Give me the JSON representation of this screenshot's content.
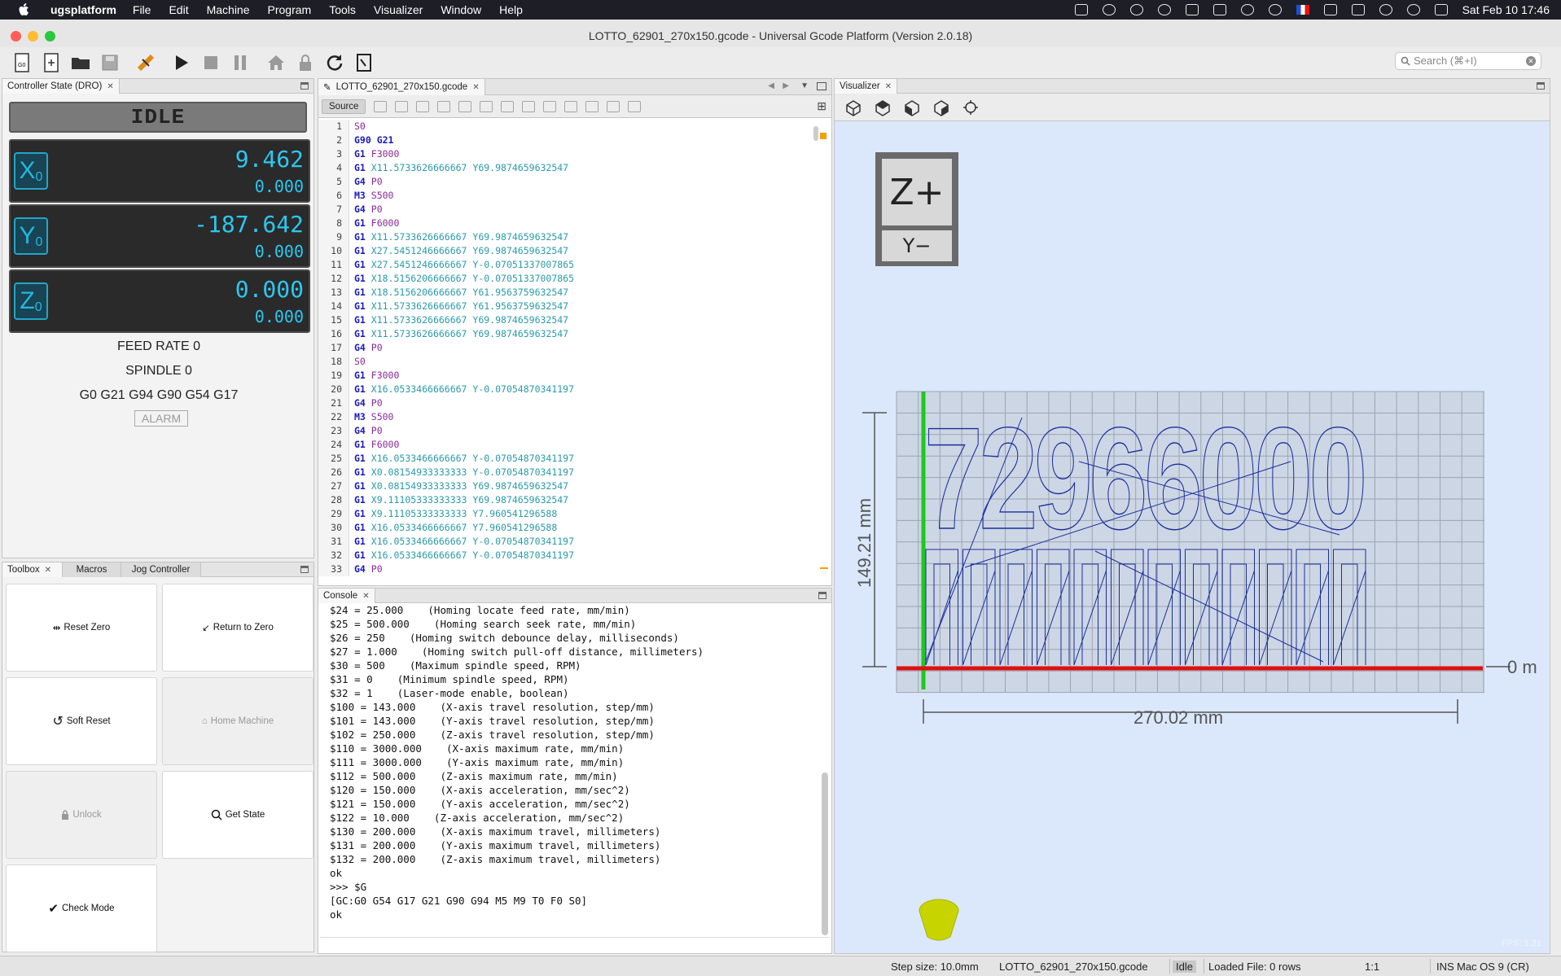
{
  "menubar": {
    "app_name": "ugsplatform",
    "items": [
      "File",
      "Edit",
      "Machine",
      "Program",
      "Tools",
      "Visualizer",
      "Window",
      "Help"
    ],
    "clock": "Sat Feb 10  17:46"
  },
  "window": {
    "title": "LOTTO_62901_270x150.gcode - Universal Gcode Platform (Version 2.0.18)"
  },
  "search": {
    "placeholder": "Search (⌘+I)"
  },
  "dro": {
    "tab": "Controller State (DRO)",
    "state": "IDLE",
    "axes": [
      {
        "name": "X",
        "sub": "0",
        "machine": "9.462",
        "work": "0.000"
      },
      {
        "name": "Y",
        "sub": "0",
        "machine": "-187.642",
        "work": "0.000"
      },
      {
        "name": "Z",
        "sub": "0",
        "machine": "0.000",
        "work": "0.000"
      }
    ],
    "feed_rate": "FEED RATE 0",
    "spindle": "SPINDLE 0",
    "gcode_state": "G0 G21 G94 G90 G54 G17",
    "alarm": "ALARM"
  },
  "toolbox": {
    "tabs": [
      "Toolbox",
      "Macros",
      "Jog Controller"
    ],
    "buttons": {
      "reset_zero": "Reset Zero",
      "return_to_zero": "Return to Zero",
      "soft_reset": "Soft Reset",
      "home_machine": "Home Machine",
      "unlock": "Unlock",
      "get_state": "Get State",
      "check_mode": "Check Mode"
    }
  },
  "editor": {
    "tab": "LOTTO_62901_270x150.gcode",
    "source_label": "Source",
    "lines": [
      [
        "S0",
        "",
        ""
      ],
      [
        "G90 G21",
        "",
        ""
      ],
      [
        "G1",
        "F3000",
        ""
      ],
      [
        "G1",
        "X11.5733626666667 Y69.9874659632547",
        ""
      ],
      [
        "G4",
        "P0",
        ""
      ],
      [
        "M3",
        "S500",
        ""
      ],
      [
        "G4",
        "P0",
        ""
      ],
      [
        "G1",
        "F6000",
        ""
      ],
      [
        "G1",
        "X11.5733626666667 Y69.9874659632547",
        ""
      ],
      [
        "G1",
        "X27.5451246666667 Y69.9874659632547",
        ""
      ],
      [
        "G1",
        "X27.5451246666667 Y-0.07051337007865",
        ""
      ],
      [
        "G1",
        "X18.5156206666667 Y-0.07051337007865",
        ""
      ],
      [
        "G1",
        "X18.5156206666667 Y61.9563759632547",
        ""
      ],
      [
        "G1",
        "X11.5733626666667 Y61.9563759632547",
        ""
      ],
      [
        "G1",
        "X11.5733626666667 Y69.9874659632547",
        ""
      ],
      [
        "G1",
        "X11.5733626666667 Y69.9874659632547",
        ""
      ],
      [
        "G4",
        "P0",
        ""
      ],
      [
        "S0",
        "",
        ""
      ],
      [
        "G1",
        "F3000",
        ""
      ],
      [
        "G1",
        "X16.0533466666667 Y-0.07054870341197",
        ""
      ],
      [
        "G4",
        "P0",
        ""
      ],
      [
        "M3",
        "S500",
        ""
      ],
      [
        "G4",
        "P0",
        ""
      ],
      [
        "G1",
        "F6000",
        ""
      ],
      [
        "G1",
        "X16.0533466666667 Y-0.07054870341197",
        ""
      ],
      [
        "G1",
        "X0.08154933333333 Y-0.07054870341197",
        ""
      ],
      [
        "G1",
        "X0.08154933333333 Y69.9874659632547",
        ""
      ],
      [
        "G1",
        "X9.11105333333333 Y69.9874659632547",
        ""
      ],
      [
        "G1",
        "X9.11105333333333 Y7.960541296588",
        ""
      ],
      [
        "G1",
        "X16.0533466666667 Y7.960541296588",
        ""
      ],
      [
        "G1",
        "X16.0533466666667 Y-0.07054870341197",
        ""
      ],
      [
        "G1",
        "X16.0533466666667 Y-0.07054870341197",
        ""
      ],
      [
        "G4",
        "P0",
        ""
      ]
    ]
  },
  "console": {
    "tab": "Console",
    "text": "$24 = 25.000    (Homing locate feed rate, mm/min)\n$25 = 500.000    (Homing search seek rate, mm/min)\n$26 = 250    (Homing switch debounce delay, milliseconds)\n$27 = 1.000    (Homing switch pull-off distance, millimeters)\n$30 = 500    (Maximum spindle speed, RPM)\n$31 = 0    (Minimum spindle speed, RPM)\n$32 = 1    (Laser-mode enable, boolean)\n$100 = 143.000    (X-axis travel resolution, step/mm)\n$101 = 143.000    (Y-axis travel resolution, step/mm)\n$102 = 250.000    (Z-axis travel resolution, step/mm)\n$110 = 3000.000    (X-axis maximum rate, mm/min)\n$111 = 3000.000    (Y-axis maximum rate, mm/min)\n$112 = 500.000    (Z-axis maximum rate, mm/min)\n$120 = 150.000    (X-axis acceleration, mm/sec^2)\n$121 = 150.000    (Y-axis acceleration, mm/sec^2)\n$122 = 10.000    (Z-axis acceleration, mm/sec^2)\n$130 = 200.000    (X-axis maximum travel, millimeters)\n$131 = 200.000    (Y-axis maximum travel, millimeters)\n$132 = 200.000    (Z-axis maximum travel, millimeters)\nok\n>>> $G\n[GC:G0 G54 G17 G21 G90 G94 M5 M9 T0 F0 S0]\nok"
  },
  "visualizer": {
    "tab": "Visualizer",
    "cube_top": "Z+",
    "cube_front": "Y−",
    "height_label": "149.21 mm",
    "width_label": "270.02 mm",
    "zero_label": "0 m",
    "fps": "FPS: 1.21",
    "preview_text": "72966000"
  },
  "statusbar": {
    "step_size": "Step size: 10.0mm",
    "file": "LOTTO_62901_270x150.gcode",
    "state": "Idle",
    "loaded": "Loaded File: 0 rows",
    "ratio": "1:1",
    "ins": "INS",
    "line_ending": "Mac OS 9 (CR)"
  }
}
